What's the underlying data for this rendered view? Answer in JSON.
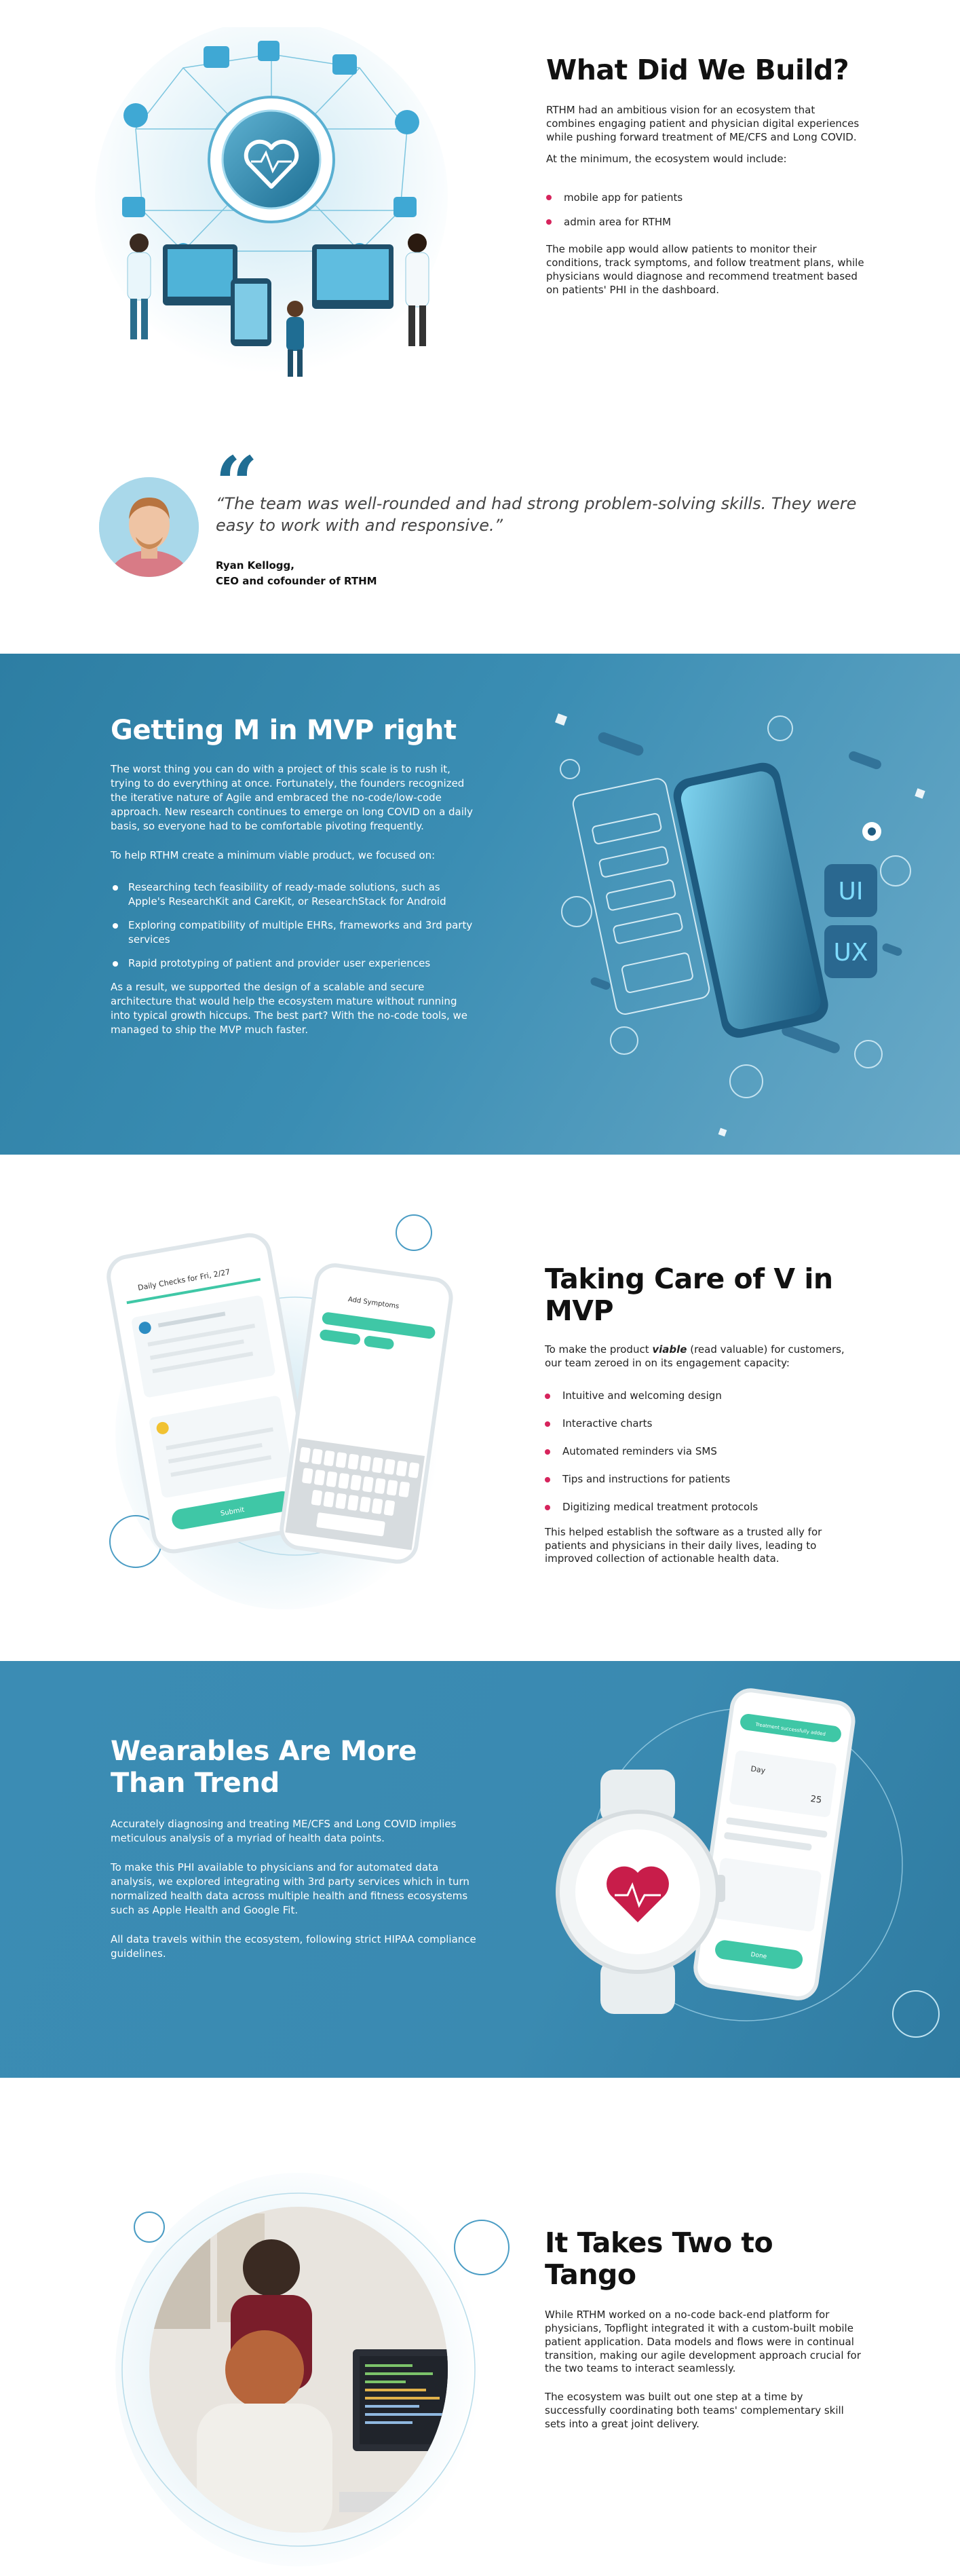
{
  "build": {
    "title": "What Did We Build?",
    "p1": "RTHM had an ambitious vision for an ecosystem that combines engaging patient and physician digital experiences while pushing forward treatment of ME/CFS and Long COVID.",
    "p2": "At the minimum, the ecosystem would include:",
    "bullets": [
      "mobile app for patients",
      "admin area for RTHM"
    ],
    "p3": "The mobile app would allow patients to monitor their conditions, track symptoms, and follow treatment plans, while physicians would diagnose and recommend treatment based on patients' PHI in the dashboard."
  },
  "testimonial": {
    "quote": "“The team was well-rounded and had strong problem-solving skills. They were easy to work with and responsive.”",
    "name": "Ryan Kellogg,",
    "role": "CEO and cofounder of RTHM"
  },
  "mvp_m": {
    "title": "Getting M in MVP right",
    "p1": "The worst thing you can do with a project of this scale is to rush it, trying to do everything at once. Fortunately, the founders recognized the iterative nature of Agile and embraced the no-code/low-code approach. New research continues to emerge on long COVID on a daily basis, so everyone had to be comfortable pivoting frequently.",
    "p2": "To help RTHM create a minimum viable product, we focused on:",
    "bullets": [
      "Researching tech feasibility of ready-made solutions, such as Apple's ResearchKit and CareKit, or ResearchStack for Android",
      "Exploring compatibility of multiple EHRs, frameworks and 3rd party services",
      "Rapid prototyping of patient and provider user experiences"
    ],
    "p3": "As a result, we supported the design of a scalable and secure architecture that would help the ecosystem mature without running into typical growth hiccups. The best part? With the no-code tools, we managed to ship the MVP much faster.",
    "ui_badge": "UI",
    "ux_badge": "UX"
  },
  "mvp_v": {
    "title": "Taking Care of V in MVP",
    "intro_a": "To make the product ",
    "intro_em": "viable",
    "intro_b": " (read valuable) for customers, our team zeroed in on its engagement capacity:",
    "bullets": [
      "Intuitive and welcoming design",
      "Interactive charts",
      "Automated reminders via SMS",
      "Tips and instructions for patients",
      "Digitizing medical treatment protocols"
    ],
    "p2": "This helped establish the software as a trusted ally for patients and physicians in their daily lives, leading to improved collection of actionable health data.",
    "phone_left_title": "Daily Checks for Fri, 2/27",
    "phone_left_button": "Submit",
    "phone_right_title": "Add Symptoms",
    "phone_right_keys": [
      "q",
      "w",
      "e",
      "r",
      "t",
      "y",
      "u",
      "i",
      "o",
      "p",
      "a",
      "s",
      "d",
      "f",
      "g",
      "h",
      "j",
      "k",
      "l",
      "z",
      "x",
      "c",
      "v",
      "b",
      "n",
      "m"
    ]
  },
  "wearables": {
    "title": "Wearables Are More Than Trend",
    "p1": "Accurately diagnosing and treating ME/CFS and Long COVID implies meticulous analysis of a myriad of health data points.",
    "p2": "To make this PHI available to physicians and for automated data analysis, we explored integrating with 3rd party services which in turn normalized health data across multiple health and fitness ecosystems such as Apple Health and Google Fit.",
    "p3": " All data travels within the ecosystem, following strict HIPAA compliance guidelines.",
    "phone_label": "Treatment successfully added",
    "phone_day": "Day",
    "phone_number": "25",
    "phone_button": "Done"
  },
  "tango": {
    "title": "It Takes Two to Tango",
    "p1": "While RTHM worked on a no-code back-end platform for physicians, Topflight integrated it with a custom-built mobile patient application. Data models and flows were in continual transition, making our agile development approach crucial for the two teams to interact seamlessly.",
    "p2": "The ecosystem was built out one step at a time by successfully coordinating both teams' complementary skill sets into a great joint delivery."
  },
  "colors": {
    "accent_pink": "#d6245c",
    "brand_blue": "#2d7ea3",
    "quote_blue": "#1f6d93"
  }
}
